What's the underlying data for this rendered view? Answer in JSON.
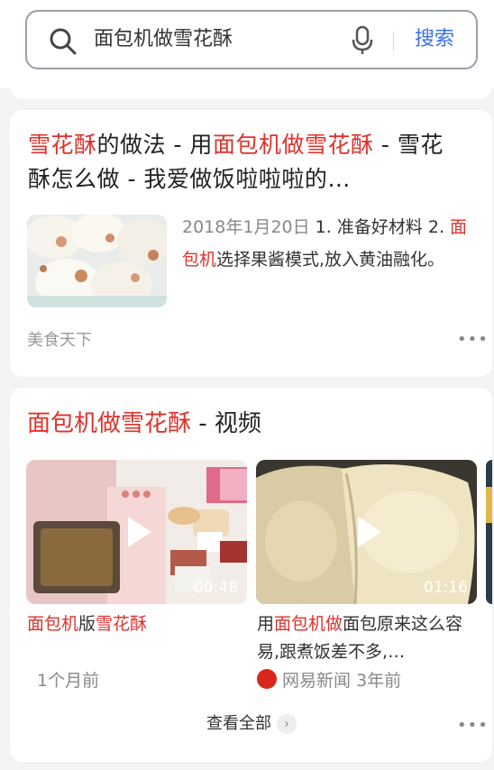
{
  "search": {
    "query": "面包机做雪花酥",
    "button_label": "搜索"
  },
  "result1": {
    "title_parts": {
      "t1": "雪花酥",
      "t2": "的做法 - 用",
      "t3": "面包机做雪花酥",
      "t4": " - 雪花酥怎么做 - 我爱做饭啦啦啦的…"
    },
    "date": "2018年1月20日",
    "snippet_parts": {
      "s1": " 1. 准备好材料 2. ",
      "s2": "面包机",
      "s3": "选择果酱模式,放入黄油融化。"
    },
    "source": "美食天下",
    "more": "•••"
  },
  "video_section": {
    "title_highlight": "面包机做雪花酥",
    "title_rest": " - 视频",
    "videos": [
      {
        "duration": "00:48",
        "caption": {
          "a": "面包机",
          "b": "版",
          "c": "雪花酥"
        },
        "meta": "1个月前"
      },
      {
        "duration": "01:16",
        "caption": {
          "a": "用",
          "b": "面包机做",
          "c": "面包原来这么容易,跟煮饭差不多,…"
        },
        "source": "网易新闻",
        "meta": "3年前"
      }
    ],
    "view_all": "查看全部",
    "more": "•••"
  },
  "colors": {
    "highlight": "#e0312a",
    "accent": "#3b6ef0"
  }
}
